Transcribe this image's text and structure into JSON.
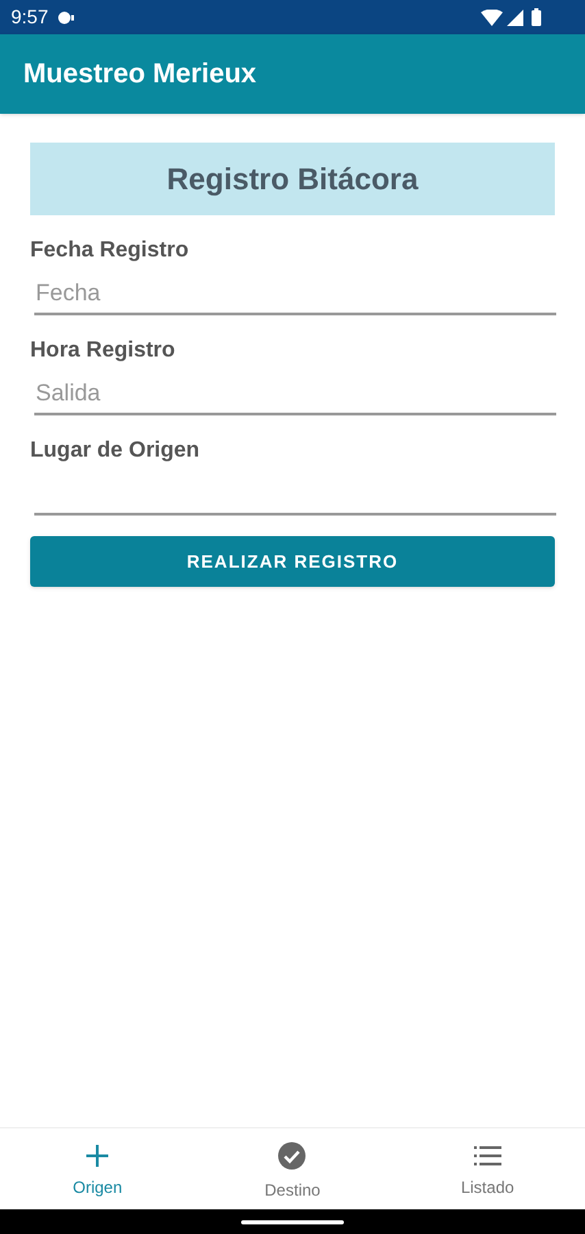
{
  "status_bar": {
    "time": "9:57"
  },
  "app_bar": {
    "title": "Muestreo Merieux"
  },
  "form": {
    "title": "Registro Bitácora",
    "fields": [
      {
        "label": "Fecha Registro",
        "placeholder": "Fecha"
      },
      {
        "label": "Hora Registro",
        "placeholder": "Salida"
      },
      {
        "label": "Lugar de Origen"
      }
    ],
    "submit": "REALIZAR REGISTRO"
  },
  "bottom_nav": [
    {
      "label": "Origen",
      "kind": "plus",
      "selected": true
    },
    {
      "label": "Destino",
      "kind": "check",
      "selected": false
    },
    {
      "label": "Listado",
      "kind": "list",
      "selected": false
    }
  ]
}
